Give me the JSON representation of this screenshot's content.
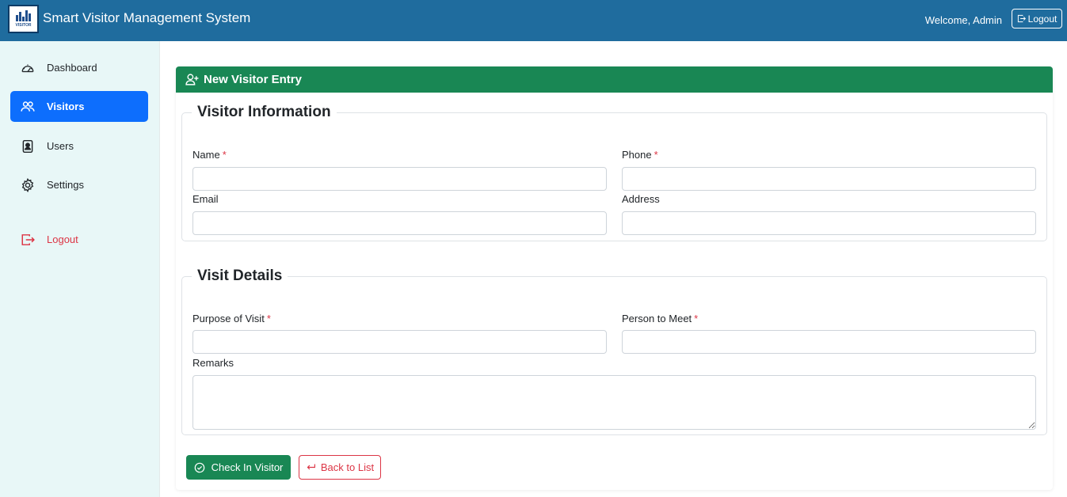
{
  "header": {
    "app_title": "Smart Visitor Management System",
    "logo_text": "VISITOR",
    "welcome_text": "Welcome, Admin",
    "logout_label": "Logout"
  },
  "sidebar": {
    "items": [
      {
        "label": "Dashboard",
        "icon": "speedometer-icon"
      },
      {
        "label": "Visitors",
        "icon": "people-icon",
        "active": true
      },
      {
        "label": "Users",
        "icon": "person-badge-icon"
      },
      {
        "label": "Settings",
        "icon": "gear-icon"
      },
      {
        "label": "Logout",
        "icon": "logout-icon"
      }
    ]
  },
  "form": {
    "title": "New Visitor Entry",
    "visitor_info": {
      "legend": "Visitor Information",
      "name_label": "Name",
      "phone_label": "Phone",
      "email_label": "Email",
      "address_label": "Address",
      "name_value": "",
      "phone_value": "",
      "email_value": "",
      "address_value": ""
    },
    "visit_details": {
      "legend": "Visit Details",
      "purpose_label": "Purpose of Visit",
      "person_label": "Person to Meet",
      "remarks_label": "Remarks",
      "purpose_value": "",
      "person_value": "",
      "remarks_value": ""
    },
    "required_mark": "*",
    "submit_label": "Check In Visitor",
    "back_label": "Back to List"
  },
  "colors": {
    "topbar": "#1f6c9e",
    "sidebar_bg": "#e8f7f7",
    "active_nav": "#0d6efd",
    "header_green": "#198754",
    "danger": "#dc3545"
  }
}
